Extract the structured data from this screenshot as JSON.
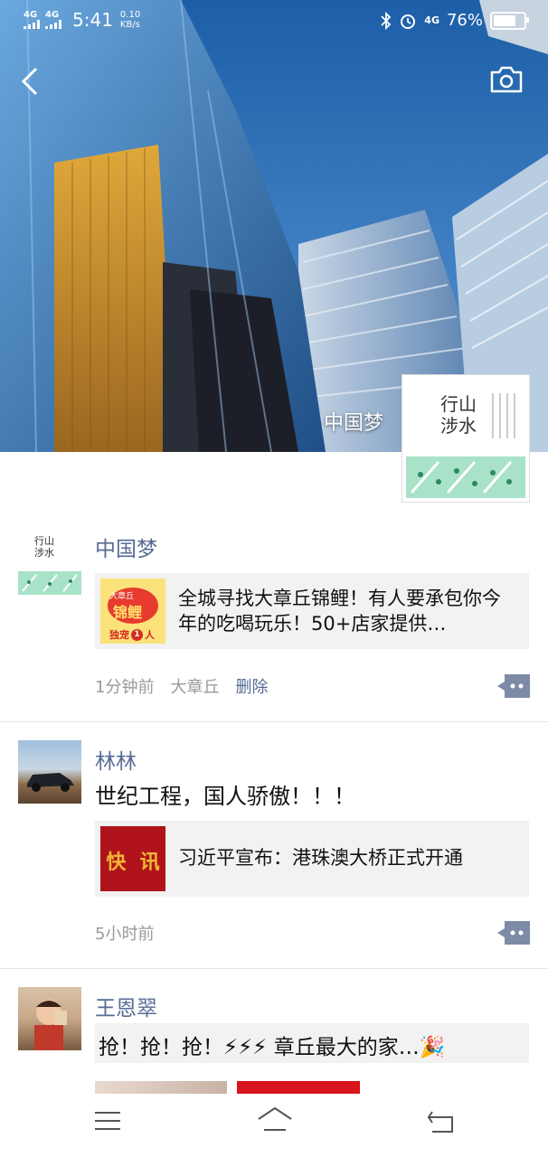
{
  "status_bar": {
    "network1": "4G",
    "network2": "4G",
    "time": "5:41",
    "speed_value": "0.10",
    "speed_unit": "KB/s",
    "network3": "4G",
    "battery_percent": "76%",
    "battery_level": 0.76
  },
  "header": {
    "back_icon": "chevron-left-icon",
    "camera_icon": "camera-icon",
    "cover_name": "中国梦",
    "profile_avatar_lines": [
      "行山",
      "涉水"
    ]
  },
  "posts": [
    {
      "name": "中国梦",
      "avatar_lines": [
        "行山",
        "涉水"
      ],
      "link_title": "全城寻找大章丘锦鲤！有人要承包你今年的吃喝玩乐！50+店家提供…",
      "link_thumb_lines": [
        "大章丘",
        "锦鲤",
        "独宠",
        "1",
        "人"
      ],
      "time": "1分钟前",
      "location": "大章丘",
      "delete": "删除"
    },
    {
      "name": "林林",
      "text": "世纪工程，国人骄傲！！！",
      "link_title": "习近平宣布：港珠澳大桥正式开通",
      "link_thumb_text": "快  讯",
      "time": "5小时前"
    },
    {
      "name": "王恩翠",
      "text": "抢！抢！抢！⚡⚡⚡ 章丘最大的家…🎉"
    }
  ],
  "nav": {
    "menu_icon": "menu-icon",
    "home_icon": "home-icon",
    "back_icon": "back-arrow-icon"
  }
}
